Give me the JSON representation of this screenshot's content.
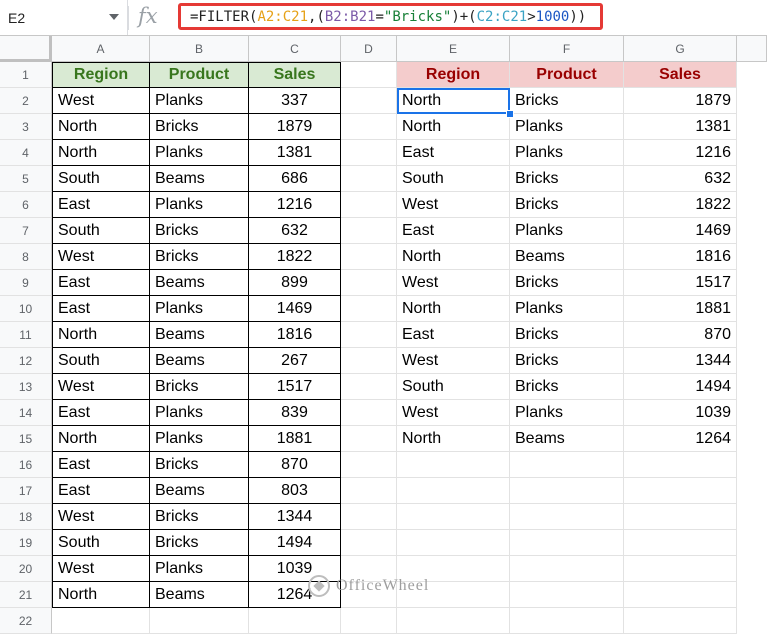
{
  "name_box": "E2",
  "formula": [
    {
      "t": "=FILTER(",
      "c": "#222222"
    },
    {
      "t": "A2:C21",
      "c": "#e6a117"
    },
    {
      "t": ",(",
      "c": "#222222"
    },
    {
      "t": "B2:B21",
      "c": "#7b5aa8"
    },
    {
      "t": "=",
      "c": "#222222"
    },
    {
      "t": "\"Bricks\"",
      "c": "#188038"
    },
    {
      "t": ")+(",
      "c": "#222222"
    },
    {
      "t": "C2:C21",
      "c": "#3aa3c4"
    },
    {
      "t": ">",
      "c": "#222222"
    },
    {
      "t": "1000",
      "c": "#1a56c4"
    },
    {
      "t": "))",
      "c": "#222222"
    }
  ],
  "columns": [
    "A",
    "B",
    "C",
    "D",
    "E",
    "F",
    "G"
  ],
  "rows": [
    "1",
    "2",
    "3",
    "4",
    "5",
    "6",
    "7",
    "8",
    "9",
    "10",
    "11",
    "12",
    "13",
    "14",
    "15",
    "16",
    "17",
    "18",
    "19",
    "20",
    "21",
    "22"
  ],
  "source_headers": [
    "Region",
    "Product",
    "Sales"
  ],
  "source_rows": [
    [
      "West",
      "Planks",
      "337"
    ],
    [
      "North",
      "Bricks",
      "1879"
    ],
    [
      "North",
      "Planks",
      "1381"
    ],
    [
      "South",
      "Beams",
      "686"
    ],
    [
      "East",
      "Planks",
      "1216"
    ],
    [
      "South",
      "Bricks",
      "632"
    ],
    [
      "West",
      "Bricks",
      "1822"
    ],
    [
      "East",
      "Beams",
      "899"
    ],
    [
      "East",
      "Planks",
      "1469"
    ],
    [
      "North",
      "Beams",
      "1816"
    ],
    [
      "South",
      "Beams",
      "267"
    ],
    [
      "West",
      "Bricks",
      "1517"
    ],
    [
      "East",
      "Planks",
      "839"
    ],
    [
      "North",
      "Planks",
      "1881"
    ],
    [
      "East",
      "Bricks",
      "870"
    ],
    [
      "East",
      "Beams",
      "803"
    ],
    [
      "West",
      "Bricks",
      "1344"
    ],
    [
      "South",
      "Bricks",
      "1494"
    ],
    [
      "West",
      "Planks",
      "1039"
    ],
    [
      "North",
      "Beams",
      "1264"
    ]
  ],
  "result_headers": [
    "Region",
    "Product",
    "Sales"
  ],
  "result_rows": [
    [
      "North",
      "Bricks",
      "1879"
    ],
    [
      "North",
      "Planks",
      "1381"
    ],
    [
      "East",
      "Planks",
      "1216"
    ],
    [
      "South",
      "Bricks",
      "632"
    ],
    [
      "West",
      "Bricks",
      "1822"
    ],
    [
      "East",
      "Planks",
      "1469"
    ],
    [
      "North",
      "Beams",
      "1816"
    ],
    [
      "West",
      "Bricks",
      "1517"
    ],
    [
      "North",
      "Planks",
      "1881"
    ],
    [
      "East",
      "Bricks",
      "870"
    ],
    [
      "West",
      "Bricks",
      "1344"
    ],
    [
      "South",
      "Bricks",
      "1494"
    ],
    [
      "West",
      "Planks",
      "1039"
    ],
    [
      "North",
      "Beams",
      "1264"
    ]
  ],
  "watermark": "OfficeWheel",
  "colors": {
    "header_green_bg": "#d9ead3",
    "header_green_text": "#38761d",
    "header_red_bg": "#f4cccc",
    "header_red_text": "#990000",
    "highlight": "#e53935",
    "selection": "#1a73e8"
  }
}
